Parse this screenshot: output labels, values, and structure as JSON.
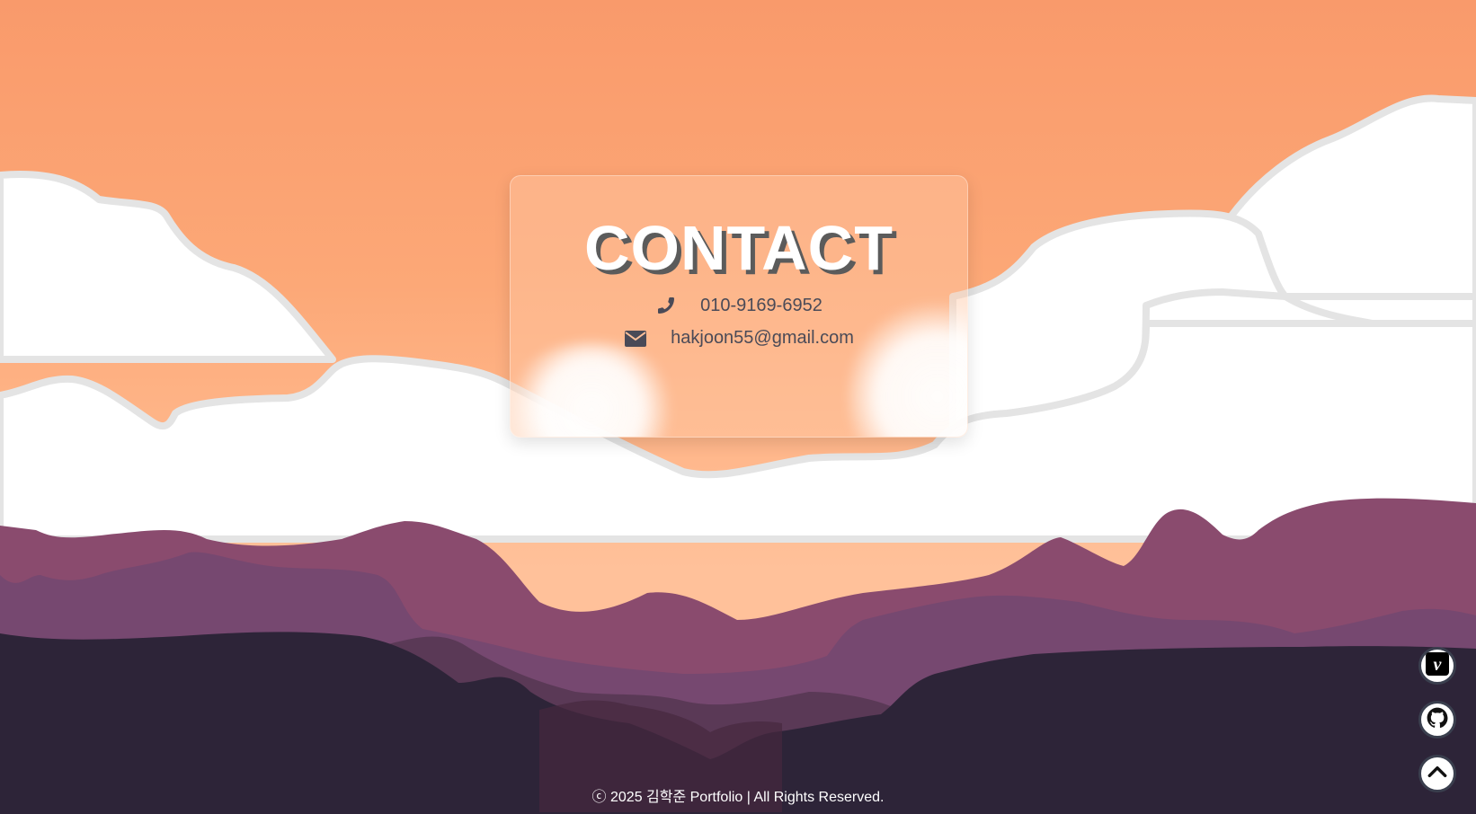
{
  "contact": {
    "title": "CONTACT",
    "phone": "010-9169-6952",
    "phone_icon": "phone-icon",
    "email": "hakjoon55@gmail.com",
    "email_icon": "envelope-icon"
  },
  "footer": {
    "text": "ⓒ 2025 김학준 Portfolio | All Rights Reserved."
  },
  "floating_buttons": [
    {
      "icon": "vimeo-icon",
      "glyph": "v"
    },
    {
      "icon": "github-icon"
    },
    {
      "icon": "chevron-up-icon"
    }
  ],
  "colors": {
    "sky_top": "#f99a6b",
    "sky_bottom": "#ffc19a",
    "cloud": "#ffffff",
    "cloud_outline": "#e4e4e4",
    "mountain_back": "#8a4b6e",
    "mountain_mid": "#764870",
    "mountain_front": "#2d2438",
    "text_dark": "#4a4a57"
  }
}
